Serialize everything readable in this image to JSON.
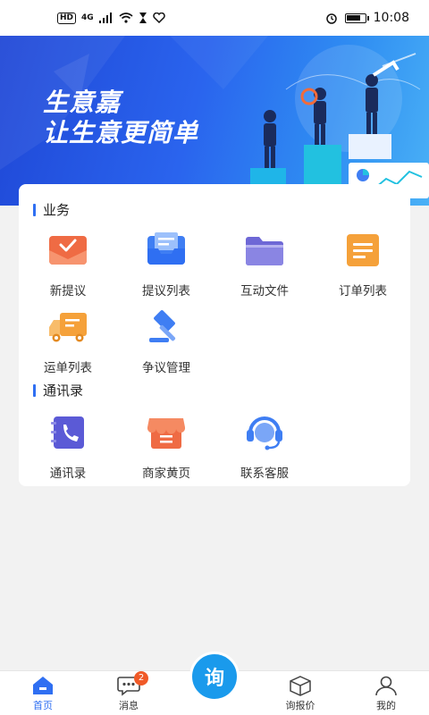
{
  "status_bar": {
    "hd": "HD",
    "network": "4G",
    "time": "10:08",
    "battery_level": 0.8
  },
  "banner": {
    "line1": "生意嘉",
    "line2": "让生意更简单"
  },
  "sections": {
    "business": {
      "title": "业务",
      "items": [
        {
          "label": "新提议",
          "icon": "envelope-check-icon",
          "color": "#ef6b44"
        },
        {
          "label": "提议列表",
          "icon": "inbox-icon",
          "color": "#3f7ef3"
        },
        {
          "label": "互动文件",
          "icon": "folder-icon",
          "color": "#6e68d6"
        },
        {
          "label": "订单列表",
          "icon": "document-icon",
          "color": "#f5a13a"
        },
        {
          "label": "运单列表",
          "icon": "truck-icon",
          "color": "#f5a13a"
        },
        {
          "label": "争议管理",
          "icon": "gavel-icon",
          "color": "#3f7ef3"
        }
      ]
    },
    "contacts": {
      "title": "通讯录",
      "items": [
        {
          "label": "通讯录",
          "icon": "phone-book-icon",
          "color": "#5b5ad6"
        },
        {
          "label": "商家黄页",
          "icon": "store-icon",
          "color": "#ef6b44"
        },
        {
          "label": "联系客服",
          "icon": "headset-icon",
          "color": "#3f7ef3"
        }
      ]
    }
  },
  "bottom_nav": {
    "home": "首页",
    "messages": "消息",
    "messages_badge": "2",
    "inquiry": "询",
    "quote": "询报价",
    "mine": "我的"
  },
  "colors": {
    "accent": "#2f6ff2",
    "center_button": "#1a9aec",
    "badge": "#f05a28"
  }
}
